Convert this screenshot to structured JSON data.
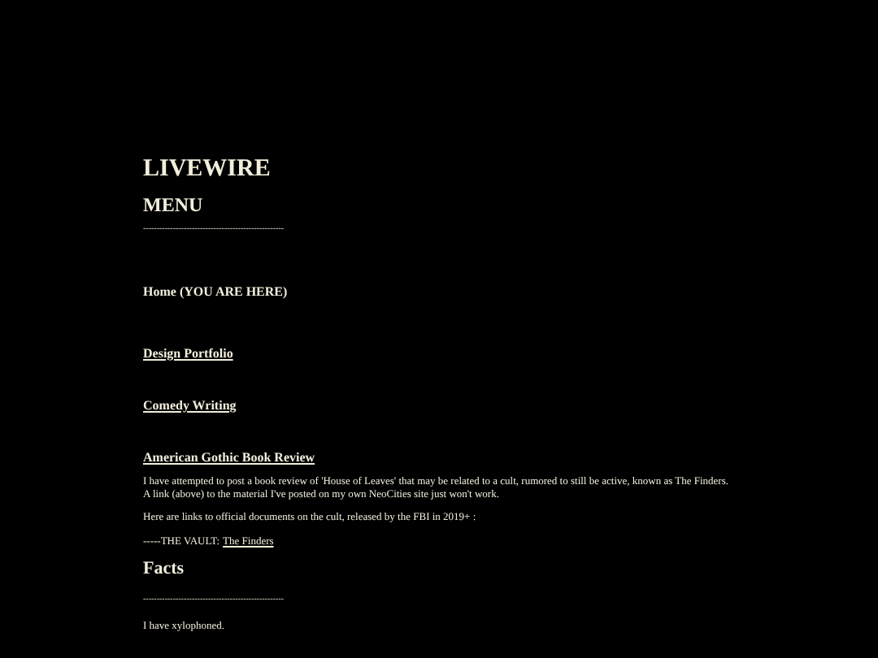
{
  "site_title": "LIVEWIRE",
  "menu_heading": "MENU",
  "divider_1": "----------------------------------------------------",
  "menu_items": [
    {
      "label": "Home (YOU ARE HERE)",
      "kind": "current"
    },
    {
      "label": "Design Portfolio",
      "kind": "link"
    },
    {
      "label": "Comedy Writing",
      "kind": "link"
    },
    {
      "label": "American Gothic Book Review",
      "kind": "link"
    }
  ],
  "intro": "I have attempted to post a book review of 'House of Leaves' that may be related to a cult, rumored to still be active, known as The Finders. A link (above) to the material I've posted on my own NeoCities site just won't work.",
  "links_note": "Here are links to official documents on the cult, released by the FBI in 2019+ :",
  "vault_prefix": "-----THE VAULT:",
  "vault_link": "The Finders",
  "facts_heading": "Facts",
  "divider_2": "----------------------------------------------------",
  "facts": [
    "I have xylophoned."
  ]
}
